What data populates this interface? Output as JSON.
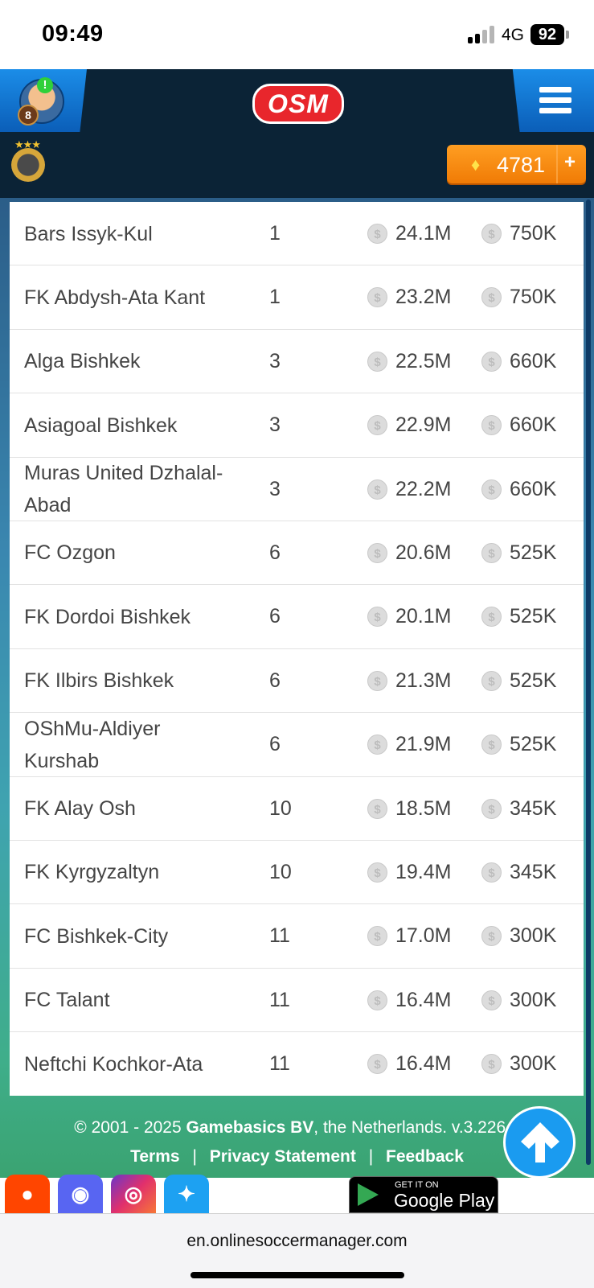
{
  "status_bar": {
    "time": "09:49",
    "network": "4G",
    "battery": "92"
  },
  "header": {
    "avatar_level": "8",
    "logo": "OSM",
    "coins": "4781",
    "coins_plus": "+"
  },
  "table": {
    "rows": [
      {
        "name": "Bars Issyk-Kul",
        "rank": "1",
        "value": "24.1M",
        "wage": "750K"
      },
      {
        "name": "FK Abdysh-Ata Kant",
        "rank": "1",
        "value": "23.2M",
        "wage": "750K"
      },
      {
        "name": "Alga Bishkek",
        "rank": "3",
        "value": "22.5M",
        "wage": "660K"
      },
      {
        "name": "Asiagoal Bishkek",
        "rank": "3",
        "value": "22.9M",
        "wage": "660K"
      },
      {
        "name": "Muras United Dzhalal-Abad",
        "rank": "3",
        "value": "22.2M",
        "wage": "660K"
      },
      {
        "name": "FC Ozgon",
        "rank": "6",
        "value": "20.6M",
        "wage": "525K"
      },
      {
        "name": "FK Dordoi Bishkek",
        "rank": "6",
        "value": "20.1M",
        "wage": "525K"
      },
      {
        "name": "FK Ilbirs Bishkek",
        "rank": "6",
        "value": "21.3M",
        "wage": "525K"
      },
      {
        "name": "OShMu-Aldiyer Kurshab",
        "rank": "6",
        "value": "21.9M",
        "wage": "525K"
      },
      {
        "name": "FK Alay Osh",
        "rank": "10",
        "value": "18.5M",
        "wage": "345K"
      },
      {
        "name": "FK Kyrgyzaltyn",
        "rank": "10",
        "value": "19.4M",
        "wage": "345K"
      },
      {
        "name": "FC Bishkek-City",
        "rank": "11",
        "value": "17.0M",
        "wage": "300K"
      },
      {
        "name": "FC Talant",
        "rank": "11",
        "value": "16.4M",
        "wage": "300K"
      },
      {
        "name": "Neftchi Kochkor-Ata",
        "rank": "11",
        "value": "16.4M",
        "wage": "300K"
      }
    ]
  },
  "footer": {
    "copyright_prefix": "© 2001 - 2025 ",
    "company": "Gamebasics BV",
    "copyright_suffix": ", the Netherlands. v.3.226.0",
    "links": {
      "terms": "Terms",
      "privacy": "Privacy Statement",
      "feedback": "Feedback"
    },
    "link_separator": "|",
    "google_play_small": "GET IT ON",
    "google_play_big": "Google Play"
  },
  "browser": {
    "url": "en.onlinesoccermanager.com"
  },
  "colors": {
    "header_bg": "#0b2336",
    "tab_blue": "#1b8de8",
    "coin_orange": "#f58a10",
    "logo_red": "#e8262c",
    "scroll_button": "#1a9bf0"
  },
  "icons": [
    "signal-icon",
    "battery-icon",
    "menu-icon",
    "gem-icon",
    "coin-icon",
    "arrow-up-icon",
    "reddit-icon",
    "discord-icon",
    "instagram-icon",
    "twitter-icon",
    "google-play-icon"
  ]
}
